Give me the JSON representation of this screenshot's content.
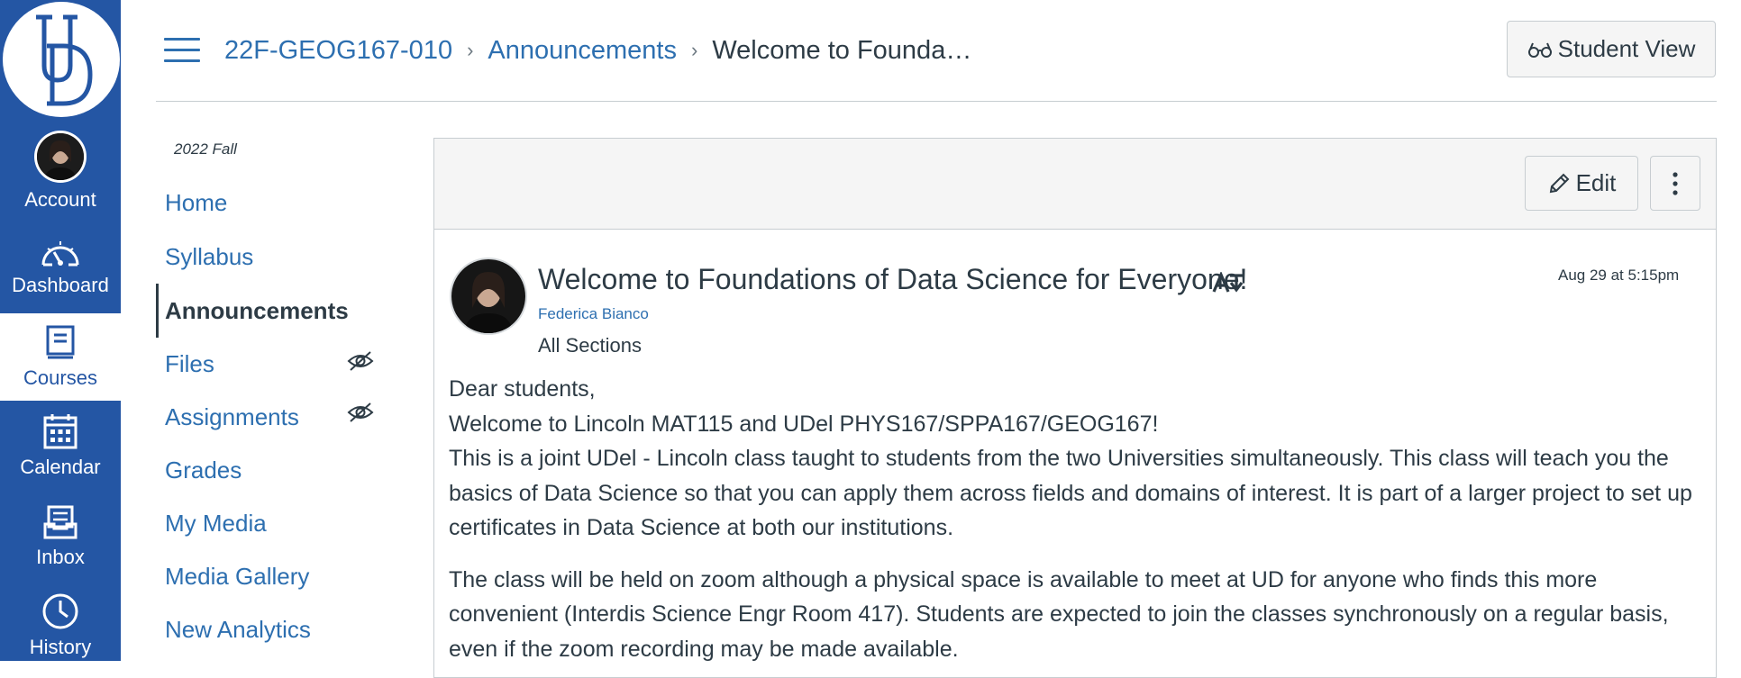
{
  "global_nav": {
    "items": [
      {
        "label": "Account",
        "icon": "account-avatar"
      },
      {
        "label": "Dashboard",
        "icon": "speedometer-icon"
      },
      {
        "label": "Courses",
        "icon": "book-icon",
        "active": true
      },
      {
        "label": "Calendar",
        "icon": "calendar-icon"
      },
      {
        "label": "Inbox",
        "icon": "inbox-icon"
      },
      {
        "label": "History",
        "icon": "clock-icon"
      }
    ],
    "brand_color": "#2456a4"
  },
  "header": {
    "breadcrumb": [
      "22F-GEOG167-010",
      "Announcements",
      "Welcome to Founda…"
    ],
    "student_view_label": "Student View"
  },
  "course_nav": {
    "term": "2022 Fall",
    "items": [
      {
        "label": "Home"
      },
      {
        "label": "Syllabus"
      },
      {
        "label": "Announcements",
        "active": true
      },
      {
        "label": "Files",
        "hidden_from_students": true
      },
      {
        "label": "Assignments",
        "hidden_from_students": true
      },
      {
        "label": "Grades"
      },
      {
        "label": "My Media"
      },
      {
        "label": "Media Gallery"
      },
      {
        "label": "New Analytics"
      }
    ]
  },
  "toolbar": {
    "edit_label": "Edit"
  },
  "announcement": {
    "title": "Welcome to Foundations of Data Science for Everyone!",
    "author": "Federica Bianco",
    "sections": "All Sections",
    "date": "Aug 29 at 5:15pm",
    "body": [
      "Dear students,",
      "Welcome to Lincoln MAT115 and UDel PHYS167/SPPA167/GEOG167!",
      "This is a joint UDel - Lincoln class taught to students from the two Universities simultaneously. This class will teach you the basics of Data Science so that you can apply them across fields and domains of interest. It is part of a larger project to set up certificates in Data Science at both our institutions.",
      "The class will be held on zoom although a physical space is available to meet at UD for anyone who finds this more convenient (Interdis Science Engr Room 417). Students are expected to join the classes synchronously on a regular basis, even if the zoom recording may be made available."
    ]
  },
  "colors": {
    "link": "#2d6fb0",
    "text": "#2d3b45",
    "border": "#c7cdd1",
    "toolbar_bg": "#f5f5f5"
  }
}
